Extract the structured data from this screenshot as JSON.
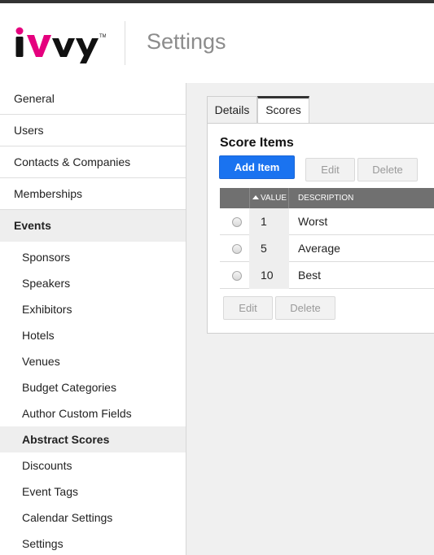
{
  "header": {
    "brand": "iVvy",
    "title": "Settings"
  },
  "sidebar": {
    "items": [
      {
        "label": "General"
      },
      {
        "label": "Users"
      },
      {
        "label": "Contacts & Companies"
      },
      {
        "label": "Memberships"
      },
      {
        "label": "Events",
        "active": true
      }
    ],
    "sub_items": [
      {
        "label": "Sponsors"
      },
      {
        "label": "Speakers"
      },
      {
        "label": "Exhibitors"
      },
      {
        "label": "Hotels"
      },
      {
        "label": "Venues"
      },
      {
        "label": "Budget Categories"
      },
      {
        "label": "Author Custom Fields"
      },
      {
        "label": "Abstract Scores",
        "active": true
      },
      {
        "label": "Discounts"
      },
      {
        "label": "Event Tags"
      },
      {
        "label": "Calendar Settings"
      },
      {
        "label": "Settings"
      }
    ]
  },
  "tabs": [
    {
      "label": "Details"
    },
    {
      "label": "Scores",
      "active": true
    }
  ],
  "panel": {
    "title": "Score Items",
    "add_label": "Add Item",
    "edit_label": "Edit",
    "delete_label": "Delete"
  },
  "table": {
    "columns": {
      "value": "VALUE",
      "description": "DESCRIPTION"
    },
    "rows": [
      {
        "value": "1",
        "description": "Worst"
      },
      {
        "value": "5",
        "description": "Average"
      },
      {
        "value": "10",
        "description": "Best"
      }
    ]
  },
  "colors": {
    "accent": "#1a73f0",
    "brand_pink": "#e5007e",
    "header_dark": "#333333",
    "table_header": "#707070"
  },
  "icons": {
    "sort": "sort-ascending-icon"
  }
}
